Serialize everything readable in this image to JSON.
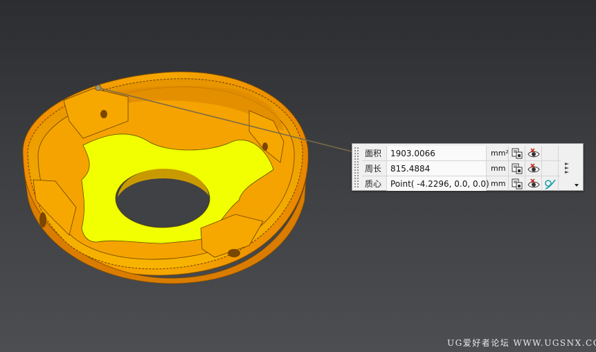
{
  "viewport": {
    "description_icon": "3d-model-viewport"
  },
  "measure_panel": {
    "rows": [
      {
        "label": "面积",
        "value": "1903.0066",
        "unit": "mm²"
      },
      {
        "label": "周长",
        "value": "815.4884",
        "unit": "mm"
      },
      {
        "label": "质心",
        "value": "Point( -4.2296, 0.0, 0.0)",
        "unit": "mm"
      }
    ],
    "icons": {
      "copy": "copy-to-clipboard-icon",
      "show": "show-hide-eye-icon",
      "point": "create-point-icon"
    },
    "colors": {
      "eye_red": "#cc2a1a",
      "point_teal": "#1aa0a8"
    }
  },
  "watermark": {
    "text": "UG爱好者论坛 WWW.UGSNX.COM"
  },
  "colors": {
    "part_orange": "#f6a500",
    "face_yellow": "#f2ff00",
    "background_top": "#2b2d30",
    "background_bottom": "#4c4e52"
  }
}
